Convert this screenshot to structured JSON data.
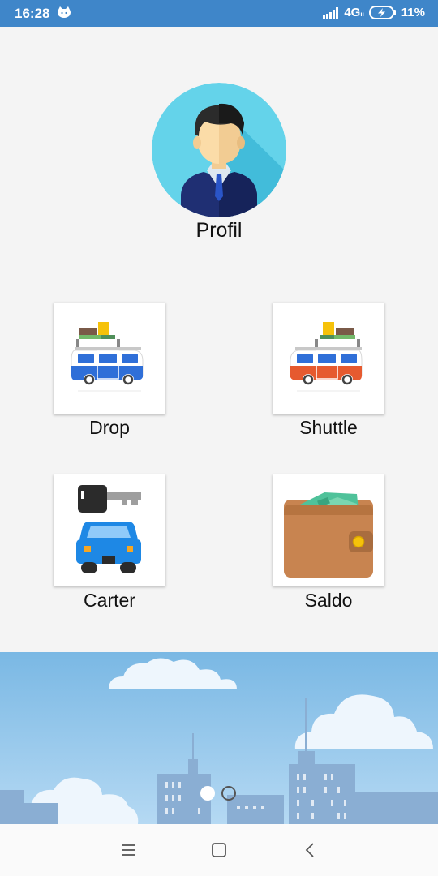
{
  "status": {
    "time": "16:28",
    "network": "4G",
    "network_sub": "ıı",
    "battery": "11%"
  },
  "profile": {
    "label": "Profil",
    "icon": "businessman-avatar-icon"
  },
  "menu": [
    {
      "label": "Drop",
      "icon": "blue-van-luggage-icon"
    },
    {
      "label": "Shuttle",
      "icon": "orange-van-luggage-icon"
    },
    {
      "label": "Carter",
      "icon": "car-key-icon"
    },
    {
      "label": "Saldo",
      "icon": "wallet-icon"
    }
  ],
  "banner": {
    "slide_count": 2,
    "active_slide": 1
  },
  "colors": {
    "status_bar": "#3f86c9",
    "sky": "#8ec3e8",
    "van_blue": "#2f6fd8",
    "van_orange": "#e65a2f",
    "car_blue": "#1e88e5",
    "wallet": "#c88450"
  }
}
